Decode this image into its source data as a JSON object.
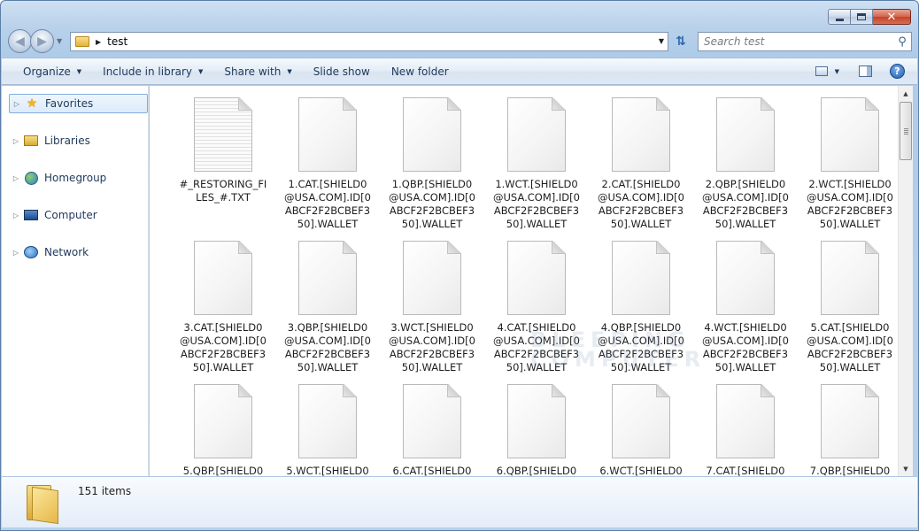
{
  "window": {
    "buttons": {
      "minimize": "minimize",
      "maximize": "maximize",
      "close": "✕"
    }
  },
  "address": {
    "path": [
      "test"
    ]
  },
  "search": {
    "placeholder": "Search test"
  },
  "toolbar": {
    "organize": "Organize",
    "include_in_library": "Include in library",
    "share_with": "Share with",
    "slide_show": "Slide show",
    "new_folder": "New folder",
    "help": "?"
  },
  "navpane": {
    "items": [
      {
        "label": "Favorites",
        "icon": "star-icon",
        "selected": true
      },
      {
        "label": "Libraries",
        "icon": "libraries-icon"
      },
      {
        "label": "Homegroup",
        "icon": "homegroup-icon"
      },
      {
        "label": "Computer",
        "icon": "computer-icon"
      },
      {
        "label": "Network",
        "icon": "network-icon"
      }
    ]
  },
  "files": [
    {
      "name": "#_RESTORING_FILES_#.TXT",
      "type": "txt"
    },
    {
      "name": "1.CAT.[SHIELD0@USA.COM].ID[0ABCF2F2BCBEF350].WALLET",
      "type": "blank"
    },
    {
      "name": "1.QBP.[SHIELD0@USA.COM].ID[0ABCF2F2BCBEF350].WALLET",
      "type": "blank"
    },
    {
      "name": "1.WCT.[SHIELD0@USA.COM].ID[0ABCF2F2BCBEF350].WALLET",
      "type": "blank"
    },
    {
      "name": "2.CAT.[SHIELD0@USA.COM].ID[0ABCF2F2BCBEF350].WALLET",
      "type": "blank"
    },
    {
      "name": "2.QBP.[SHIELD0@USA.COM].ID[0ABCF2F2BCBEF350].WALLET",
      "type": "blank"
    },
    {
      "name": "2.WCT.[SHIELD0@USA.COM].ID[0ABCF2F2BCBEF350].WALLET",
      "type": "blank"
    },
    {
      "name": "3.CAT.[SHIELD0@USA.COM].ID[0ABCF2F2BCBEF350].WALLET",
      "type": "blank"
    },
    {
      "name": "3.QBP.[SHIELD0@USA.COM].ID[0ABCF2F2BCBEF350].WALLET",
      "type": "blank"
    },
    {
      "name": "3.WCT.[SHIELD0@USA.COM].ID[0ABCF2F2BCBEF350].WALLET",
      "type": "blank"
    },
    {
      "name": "4.CAT.[SHIELD0@USA.COM].ID[0ABCF2F2BCBEF350].WALLET",
      "type": "blank"
    },
    {
      "name": "4.QBP.[SHIELD0@USA.COM].ID[0ABCF2F2BCBEF350].WALLET",
      "type": "blank"
    },
    {
      "name": "4.WCT.[SHIELD0@USA.COM].ID[0ABCF2F2BCBEF350].WALLET",
      "type": "blank"
    },
    {
      "name": "5.CAT.[SHIELD0@USA.COM].ID[0ABCF2F2BCBEF350].WALLET",
      "type": "blank"
    },
    {
      "name": "5.QBP.[SHIELD0",
      "type": "blank"
    },
    {
      "name": "5.WCT.[SHIELD0",
      "type": "blank"
    },
    {
      "name": "6.CAT.[SHIELD0",
      "type": "blank"
    },
    {
      "name": "6.QBP.[SHIELD0",
      "type": "blank"
    },
    {
      "name": "6.WCT.[SHIELD0",
      "type": "blank"
    },
    {
      "name": "7.CAT.[SHIELD0",
      "type": "blank"
    },
    {
      "name": "7.QBP.[SHIELD0",
      "type": "blank"
    }
  ],
  "details": {
    "item_count": "151 items"
  },
  "watermark": {
    "line1": "BLEEPING",
    "line2": "COMPUTER"
  }
}
